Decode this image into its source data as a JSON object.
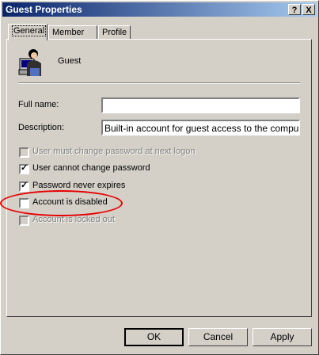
{
  "window": {
    "title": "Guest Properties",
    "help_glyph": "?",
    "close_glyph": "X"
  },
  "tabs": [
    {
      "label": "General",
      "active": true
    },
    {
      "label": "Member Of",
      "active": false
    },
    {
      "label": "Profile",
      "active": false
    }
  ],
  "user": {
    "name": "Guest",
    "icon": "user-account-icon"
  },
  "fields": {
    "full_name_label": "Full name:",
    "full_name_value": "",
    "description_label": "Description:",
    "description_value": "Built-in account for guest access to the computer/d"
  },
  "checkboxes": [
    {
      "label": "User must change password at next logon",
      "checked": false,
      "enabled": false
    },
    {
      "label": "User cannot change password",
      "checked": true,
      "enabled": true
    },
    {
      "label": "Password never expires",
      "checked": true,
      "enabled": true
    },
    {
      "label": "Account is disabled",
      "checked": false,
      "enabled": true
    },
    {
      "label": "Account is locked out",
      "checked": false,
      "enabled": false
    }
  ],
  "buttons": {
    "ok": "OK",
    "cancel": "Cancel",
    "apply": "Apply"
  },
  "colors": {
    "titlebar_start": "#0a246a",
    "titlebar_end": "#a6caf0",
    "annotation": "#e60000",
    "face": "#d4d0c8"
  }
}
